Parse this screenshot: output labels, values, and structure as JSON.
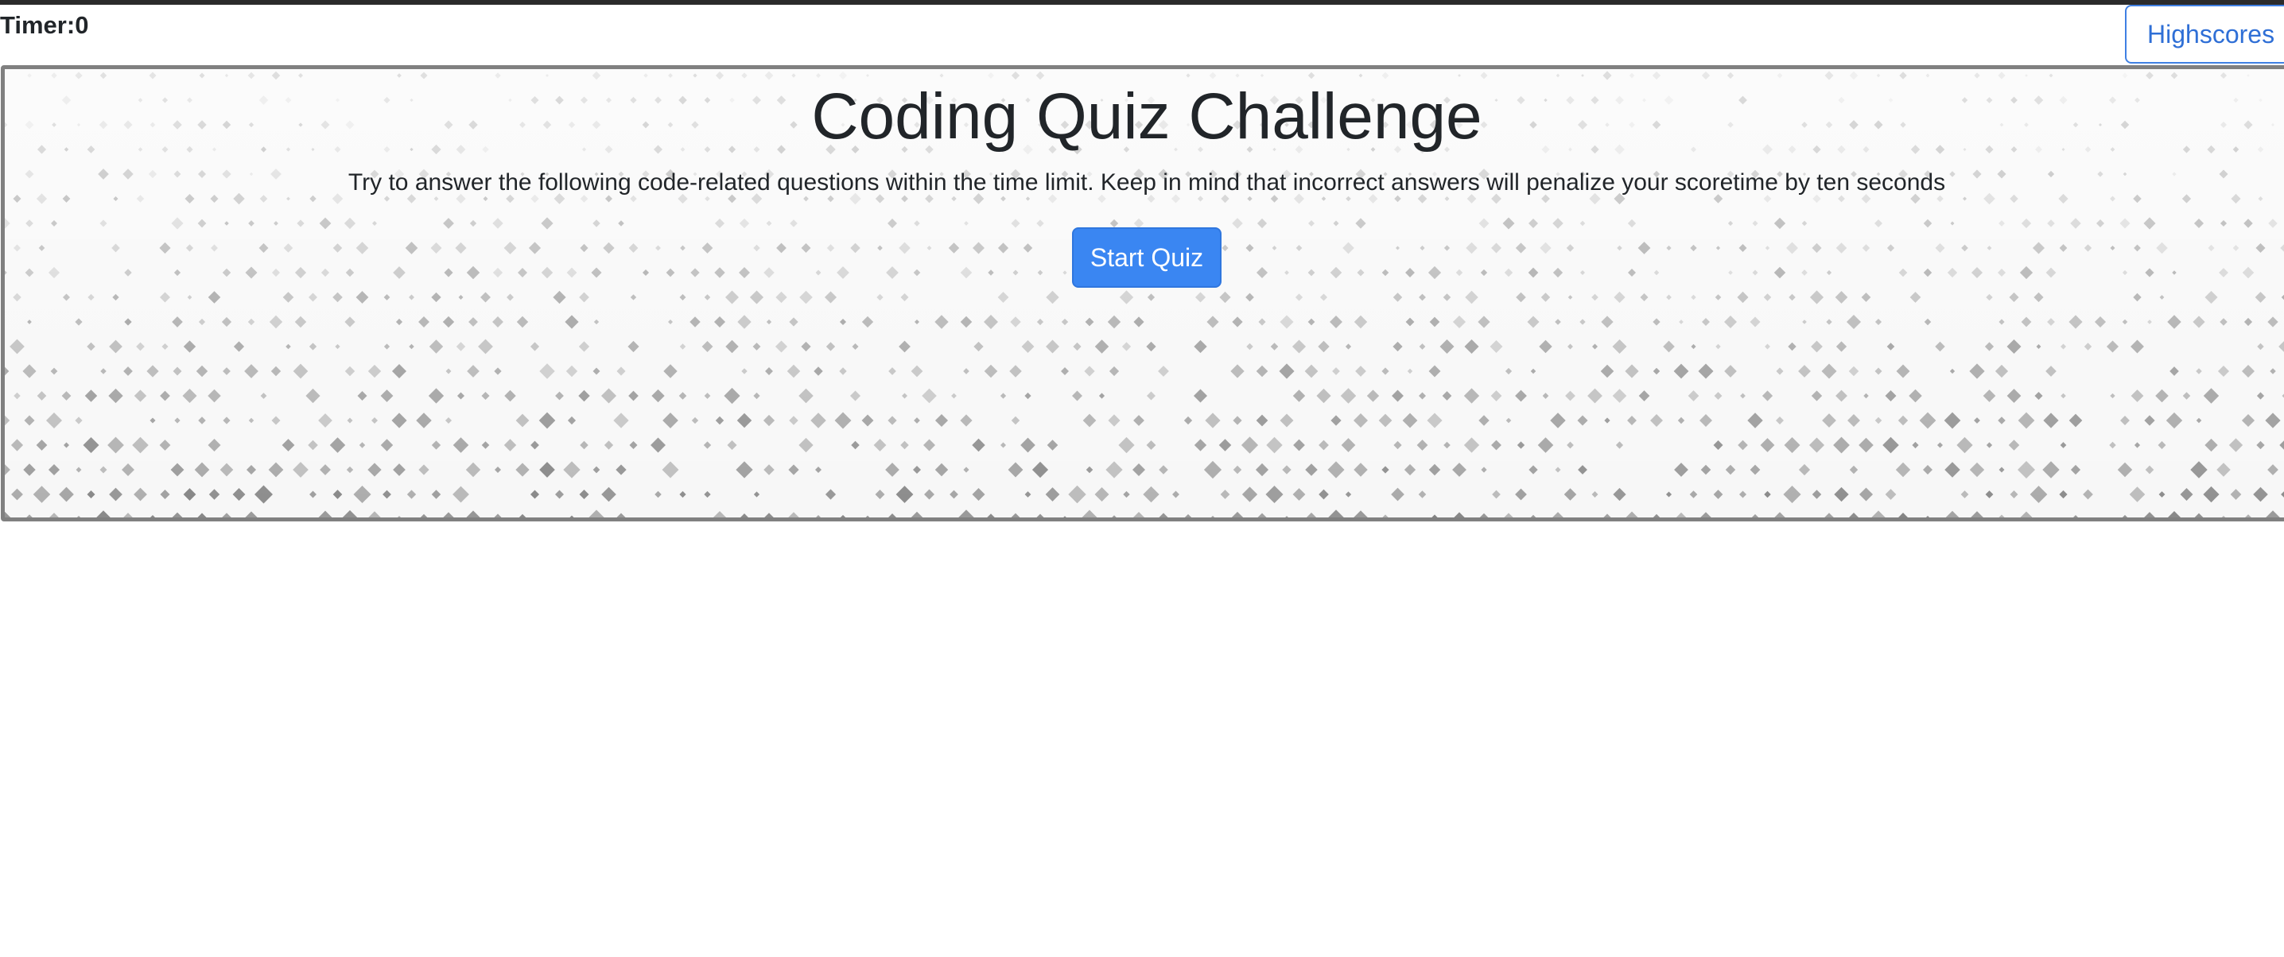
{
  "header": {
    "timer_label": "Timer:",
    "timer_value": "0",
    "highscores_label": "Highscores"
  },
  "hero": {
    "title": "Coding Quiz Challenge",
    "subtitle": "Try to answer the following code-related questions within the time limit. Keep in mind that incorrect answers will penalize your scoretime by ten seconds",
    "start_button_label": "Start Quiz"
  },
  "colors": {
    "accent": "#3a86f2",
    "outline_button_text": "#2f6fd6",
    "hero_border": "#808080",
    "text": "#212529",
    "top_rule": "#2b2b2b"
  }
}
